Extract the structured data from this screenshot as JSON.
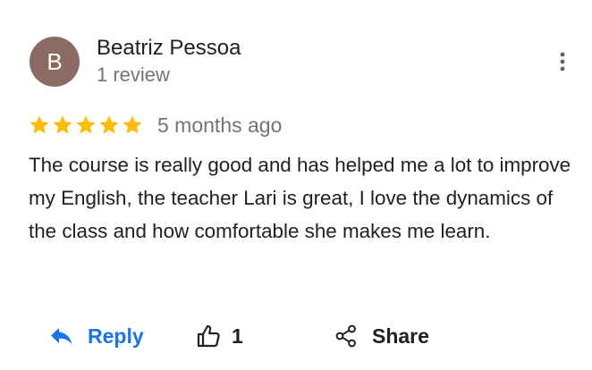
{
  "review": {
    "author": {
      "initial": "B",
      "name": "Beatriz Pessoa",
      "meta": "1 review",
      "avatar_color": "#8b6b63"
    },
    "rating": 5,
    "max_rating": 5,
    "star_color": "#fbbc04",
    "date": "5 months ago",
    "text": "The course is really good and has helped me a lot to improve my English, the teacher Lari is great, I love the dynamics of the class and how comfortable she makes me learn."
  },
  "actions": {
    "reply_label": "Reply",
    "like_count": "1",
    "share_label": "Share",
    "accent_color": "#1a73e8"
  },
  "icons": {
    "avatar": "avatar",
    "more": "more-vert-icon",
    "star": "star-icon",
    "reply": "reply-icon",
    "like": "thumb-up-icon",
    "share": "share-icon"
  }
}
